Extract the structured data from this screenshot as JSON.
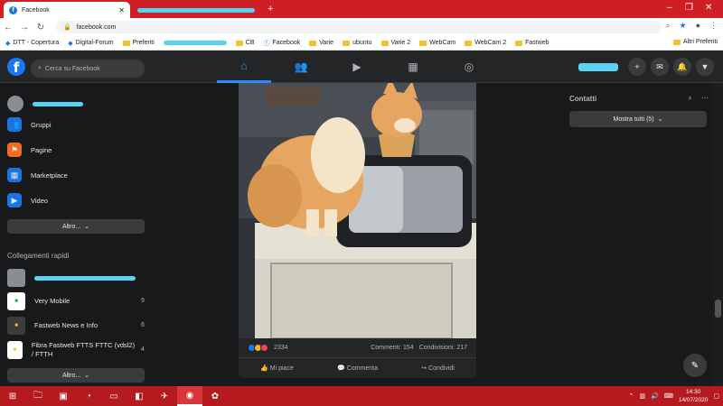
{
  "browser": {
    "active_tab_title": "Facebook",
    "url": "facebook.com",
    "new_tab_glyph": "+",
    "bookmarks": [
      {
        "label": "DTT - Copertura",
        "icon": "site"
      },
      {
        "label": "Digital-Forum",
        "icon": "site"
      },
      {
        "label": "Preferiti",
        "icon": "folder"
      },
      {
        "label": "CB",
        "icon": "folder"
      },
      {
        "label": "Facebook",
        "icon": "facebook"
      },
      {
        "label": "Varie",
        "icon": "folder"
      },
      {
        "label": "ubuntu",
        "icon": "folder"
      },
      {
        "label": "Varie 2",
        "icon": "folder"
      },
      {
        "label": "WebCam",
        "icon": "folder"
      },
      {
        "label": "WebCam 2",
        "icon": "folder"
      },
      {
        "label": "Fastweb",
        "icon": "folder"
      }
    ],
    "other_bookmarks": "Altri Preferiti"
  },
  "facebook": {
    "search_placeholder": "Cerca su Facebook",
    "left_menu": [
      {
        "label": "Gruppi",
        "icon": "groups-icon",
        "color": "#1b74e4"
      },
      {
        "label": "Pagine",
        "icon": "flag-icon",
        "color": "#f36c22"
      },
      {
        "label": "Marketplace",
        "icon": "marketplace-icon",
        "color": "#1b74e4"
      },
      {
        "label": "Video",
        "icon": "video-icon",
        "color": "#1b74e4"
      }
    ],
    "more_label": "Altro...",
    "shortcuts_title": "Collegamenti rapidi",
    "shortcuts": [
      {
        "label": "Very Mobile",
        "count": "9"
      },
      {
        "label": "Fastweb News e Info",
        "count": "6"
      },
      {
        "label": "Fibra Fastweb FTTS FTTC (vdsl2) / FTTH",
        "count": "4"
      }
    ],
    "post": {
      "reaction_count": "2334",
      "comments": "Commenti: 154",
      "shares": "Condivisioni: 217",
      "like_label": "Mi piace",
      "comment_label": "Commenta",
      "share_label": "Condividi"
    },
    "contacts_title": "Contatti",
    "show_all_label": "Mostra tutti (5)"
  },
  "taskbar": {
    "time": "14:30",
    "date": "14/07/2020"
  },
  "colors": {
    "fb_blue": "#1877f2",
    "chrome_red": "#cf1f25",
    "taskbar_red": "#b51a1f"
  }
}
